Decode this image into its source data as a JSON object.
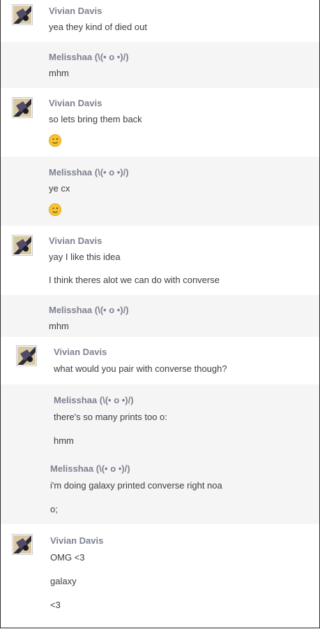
{
  "messages": [
    {
      "sender": "Vivian Davis",
      "lines": [
        "yea they kind of died out"
      ]
    },
    {
      "sender": "Melisshaa (\\(• o •)/)",
      "lines": [
        "mhm"
      ]
    },
    {
      "sender": "Vivian Davis",
      "lines": [
        "so lets bring them back"
      ],
      "emoji": "winking-face-emoji"
    },
    {
      "sender": "Melisshaa (\\(• o •)/)",
      "lines": [
        "ye cx"
      ],
      "emoji": "winking-face-emoji"
    },
    {
      "sender": "Vivian Davis",
      "lines": [
        "yay I like this idea",
        "I think theres alot we can do with converse"
      ]
    },
    {
      "sender": "Melisshaa (\\(• o •)/)",
      "lines": [
        "mhm"
      ]
    },
    {
      "sender": "Vivian Davis",
      "lines": [
        "what would you pair with converse though?"
      ]
    },
    {
      "sender": "Melisshaa (\\(• o •)/)",
      "lines": [
        "there's so many prints too o:",
        "hmm"
      ]
    },
    {
      "sender": "Melisshaa (\\(• o •)/)",
      "lines": [
        "i'm doing galaxy printed converse right noa",
        "o;"
      ]
    },
    {
      "sender": "Vivian Davis",
      "lines": [
        "OMG <3",
        "galaxy",
        "<3"
      ]
    }
  ],
  "colors": {
    "alt_background": "#f5f5f6",
    "sender_name": "#7e8291",
    "message_text": "#3d3d3d"
  }
}
